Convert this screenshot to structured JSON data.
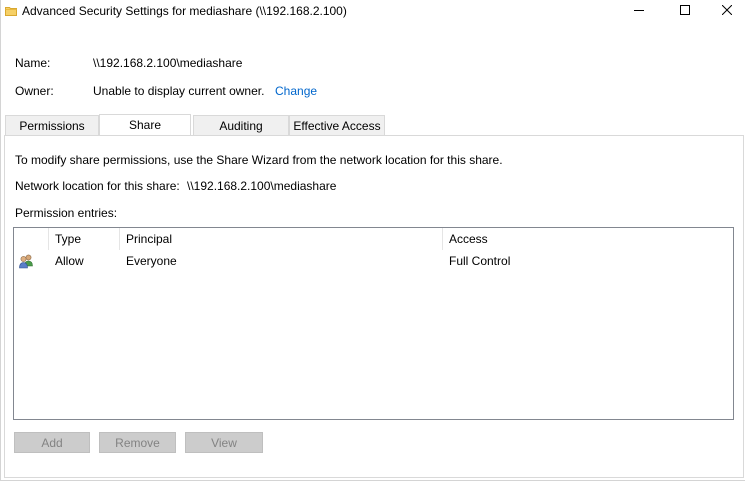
{
  "window": {
    "title": "Advanced Security Settings for mediashare (\\\\192.168.2.100)",
    "icons": {
      "title": "folder-icon",
      "minimize": "minimize-icon",
      "maximize": "maximize-icon",
      "close": "close-icon"
    }
  },
  "info": {
    "name_label": "Name:",
    "name_value": "\\\\192.168.2.100\\mediashare",
    "owner_label": "Owner:",
    "owner_value": "Unable to display current owner.",
    "owner_change": "Change"
  },
  "tabs": [
    {
      "label": "Permissions",
      "active": false
    },
    {
      "label": "Share",
      "active": true
    },
    {
      "label": "Auditing",
      "active": false
    },
    {
      "label": "Effective Access",
      "active": false
    }
  ],
  "share": {
    "instruction": "To modify share permissions, use the Share Wizard from the network location for this share.",
    "network_location_label": "Network location for this share:",
    "network_location_value": "\\\\192.168.2.100\\mediashare",
    "entries_label": "Permission entries:"
  },
  "entries_table": {
    "columns": [
      "Type",
      "Principal",
      "Access"
    ],
    "rows": [
      {
        "icon": "users-group-icon",
        "type": "Allow",
        "principal": "Everyone",
        "access": "Full Control"
      }
    ]
  },
  "buttons": {
    "add": "Add",
    "remove": "Remove",
    "view": "View",
    "enabled": false
  },
  "colors": {
    "link": "#0066cc",
    "disabled_button_bg": "#cccccc",
    "disabled_button_text": "#838383"
  }
}
